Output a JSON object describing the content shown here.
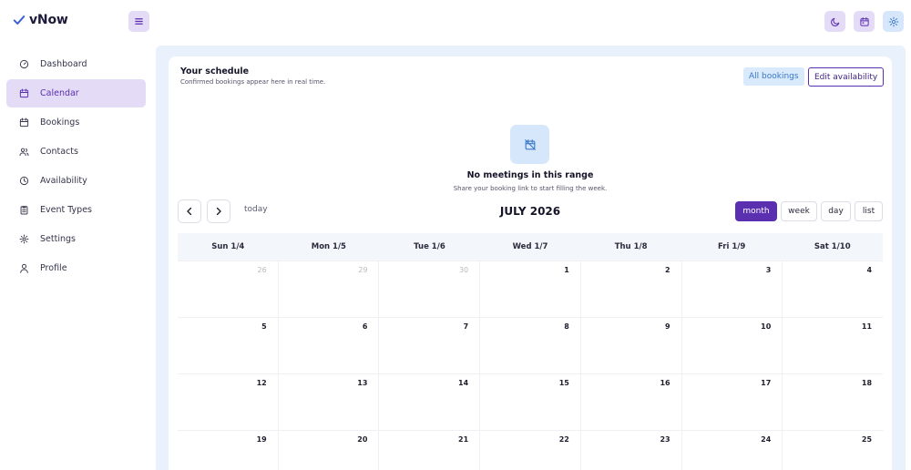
{
  "app": {
    "name": "vNow"
  },
  "sidebar": {
    "items": [
      {
        "label": "Dashboard",
        "icon": "gauge-icon"
      },
      {
        "label": "Calendar",
        "icon": "calendar-icon",
        "active": true
      },
      {
        "label": "Bookings",
        "icon": "calendar-check-icon"
      },
      {
        "label": "Contacts",
        "icon": "users-icon"
      },
      {
        "label": "Availability",
        "icon": "clock-icon"
      },
      {
        "label": "Event Types",
        "icon": "clipboard-icon"
      },
      {
        "label": "Settings",
        "icon": "gear-icon"
      },
      {
        "label": "Profile",
        "icon": "user-icon"
      }
    ]
  },
  "schedule": {
    "title": "Your schedule",
    "subtitle": "Confirmed bookings appear here in real time.",
    "all_bookings_label": "All bookings",
    "edit_availability_label": "Edit availability"
  },
  "empty_state": {
    "title": "No meetings in this range",
    "subtitle": "Share your booking link to start filling the week."
  },
  "calendar": {
    "today_label": "today",
    "month_title": "JULY 2026",
    "views": [
      "month",
      "week",
      "day",
      "list"
    ],
    "active_view": "month",
    "day_headers": [
      "Sun 1/4",
      "Mon 1/5",
      "Tue 1/6",
      "Wed 1/7",
      "Thu 1/8",
      "Fri 1/9",
      "Sat 1/10"
    ],
    "weeks": [
      [
        "26",
        "29",
        "30",
        "1",
        "2",
        "3",
        "4"
      ],
      [
        "5",
        "6",
        "7",
        "8",
        "9",
        "10",
        "11"
      ],
      [
        "12",
        "13",
        "14",
        "15",
        "16",
        "17",
        "18"
      ],
      [
        "19",
        "20",
        "21",
        "22",
        "23",
        "24",
        "25"
      ]
    ],
    "muted_days": [
      "26",
      "29",
      "30"
    ]
  },
  "colors": {
    "accent": "#5a2fb0",
    "accent_light": "#e4dbf6",
    "blue_light": "#d6e7fb",
    "main_bg": "#e8f1fc"
  }
}
